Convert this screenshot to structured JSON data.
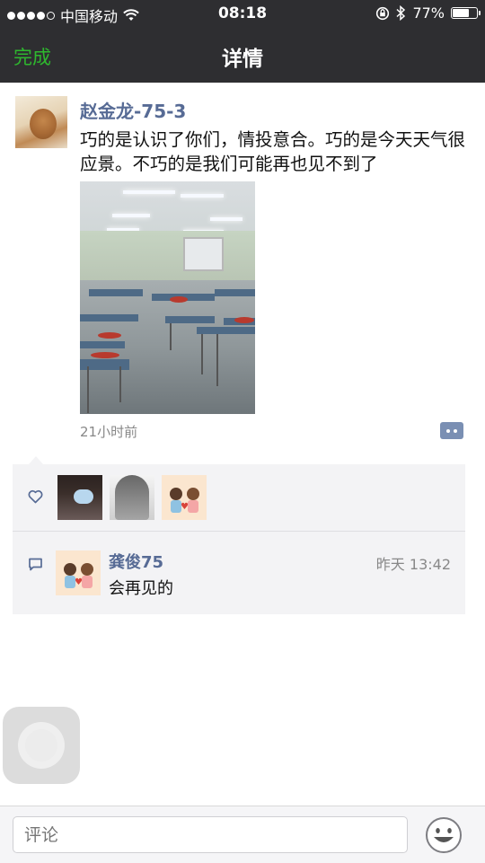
{
  "status_bar": {
    "carrier": "中国移动",
    "time": "08:18",
    "battery": "77%",
    "battery_level": 0.77
  },
  "nav": {
    "done_label": "完成",
    "title": "详情"
  },
  "post": {
    "author": "赵金龙-75-3",
    "text": "巧的是认识了你们，情投意合。巧的是今天天气很应景。不巧的是我们可能再也见不到了",
    "time": "21小时前"
  },
  "comments": [
    {
      "author": "龚俊75",
      "time": "昨天 13:42",
      "text": "会再见的"
    }
  ],
  "input": {
    "placeholder": "评论"
  },
  "colors": {
    "nav_bg": "#2e2e31",
    "done_green": "#2eb82e",
    "name_blue": "#576b95",
    "panel_bg": "#f3f3f5"
  }
}
